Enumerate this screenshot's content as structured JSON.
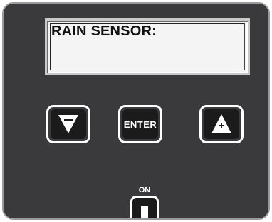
{
  "display": {
    "text": "RAIN SENSOR:"
  },
  "keys": {
    "down": {
      "icon": "minus-down-triangle-icon"
    },
    "enter": {
      "label": "ENTER"
    },
    "up": {
      "icon": "plus-up-triangle-icon"
    }
  },
  "power": {
    "label": "ON"
  },
  "colors": {
    "panel": "#3a3a3c",
    "key_face": "#1b1b1c",
    "outline": "#ffffff",
    "lcd_background": "#f4f4f4"
  }
}
